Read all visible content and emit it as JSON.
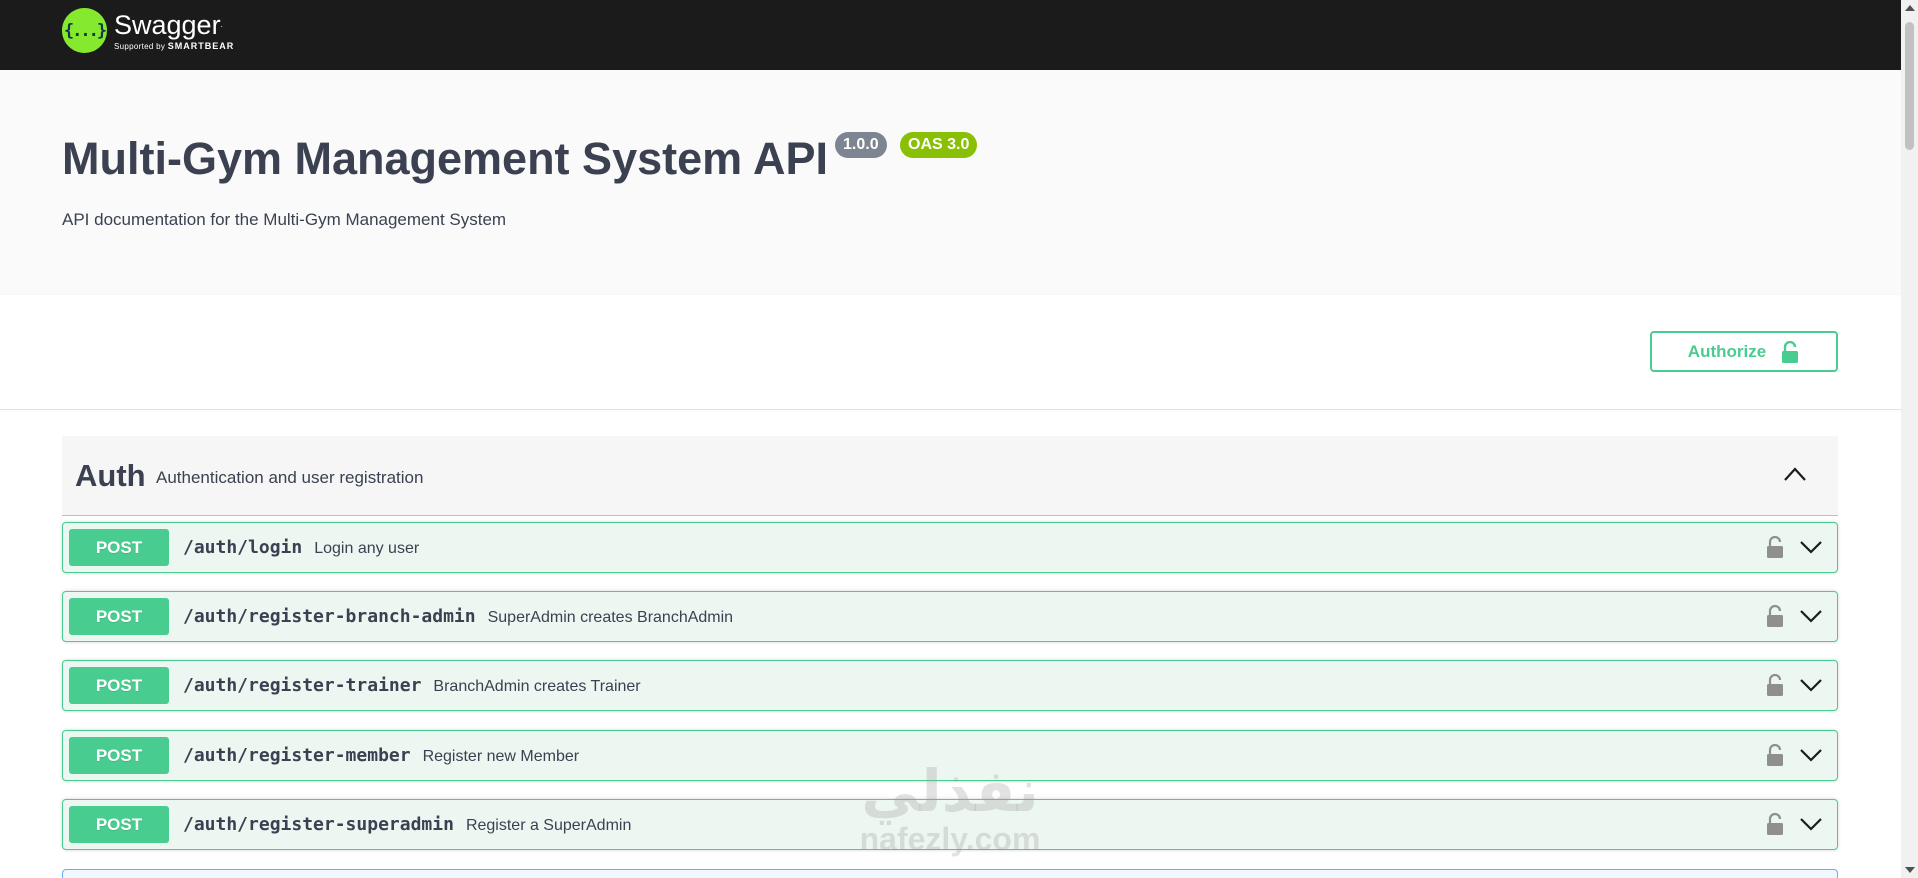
{
  "header": {
    "brand": "Swagger",
    "brand_mark": "{...}",
    "supported_by": "Supported by",
    "smartbear": "SMARTBEAR"
  },
  "info": {
    "title": "Multi-Gym Management System API",
    "version": "1.0.0",
    "oas": "OAS 3.0",
    "description": "API documentation for the Multi-Gym Management System"
  },
  "authorize": {
    "label": "Authorize",
    "icon": "unlocked-lock-icon"
  },
  "tag": {
    "name": "Auth",
    "description": "Authentication and user registration",
    "toggle_icon": "chevron-up-icon"
  },
  "operations": [
    {
      "method": "POST",
      "path": "/auth/login",
      "summary": "Login any user"
    },
    {
      "method": "POST",
      "path": "/auth/register-branch-admin",
      "summary": "SuperAdmin creates BranchAdmin"
    },
    {
      "method": "POST",
      "path": "/auth/register-trainer",
      "summary": "BranchAdmin creates Trainer"
    },
    {
      "method": "POST",
      "path": "/auth/register-member",
      "summary": "Register new Member"
    },
    {
      "method": "POST",
      "path": "/auth/register-superadmin",
      "summary": "Register a SuperAdmin"
    }
  ],
  "watermark": {
    "arabic": "نفذلي",
    "latin": "nafezly.com"
  },
  "colors": {
    "topbar": "#1b1b1b",
    "swagger_green": "#85ea2d",
    "post": "#49cc90",
    "post_bg": "#edf7f1",
    "version_badge": "#7d8492",
    "oas_badge": "#89bf04",
    "text": "#3b4151"
  }
}
